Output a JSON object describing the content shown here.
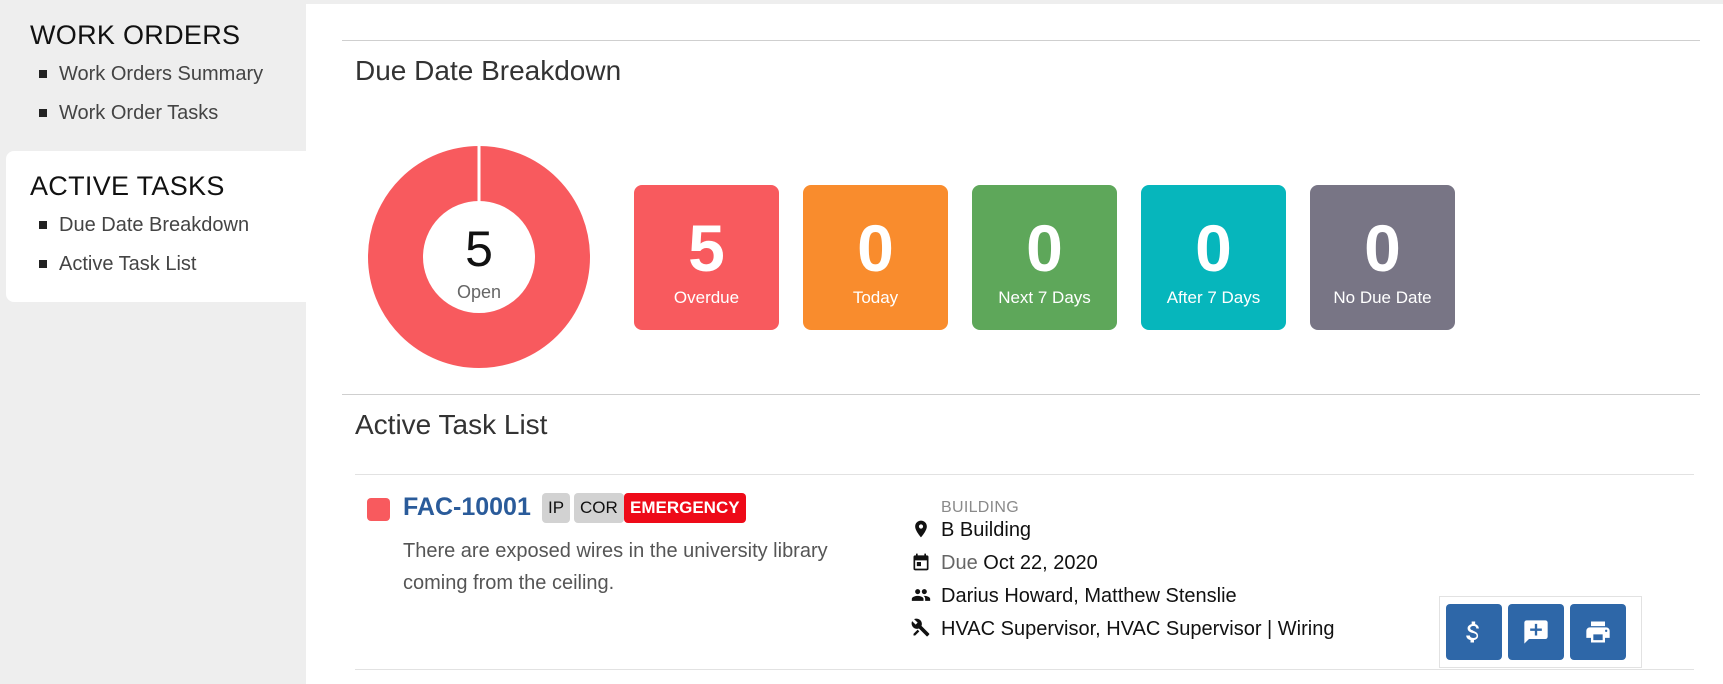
{
  "sidebar": {
    "groups": [
      {
        "title": "WORK ORDERS",
        "items": [
          {
            "label": "Work Orders Summary"
          },
          {
            "label": "Work Order Tasks"
          }
        ]
      },
      {
        "title": "ACTIVE TASKS",
        "items": [
          {
            "label": "Due Date Breakdown"
          },
          {
            "label": "Active Task List"
          }
        ]
      }
    ]
  },
  "breakdown": {
    "title": "Due Date Breakdown",
    "donut": {
      "value": "5",
      "label": "Open",
      "color": "#f85a5e"
    },
    "tiles": [
      {
        "value": "5",
        "label": "Overdue",
        "color": "#f85a5e"
      },
      {
        "value": "0",
        "label": "Today",
        "color": "#f98c2d"
      },
      {
        "value": "0",
        "label": "Next 7 Days",
        "color": "#5ea75a"
      },
      {
        "value": "0",
        "label": "After 7 Days",
        "color": "#06b6bc"
      },
      {
        "value": "0",
        "label": "No Due Date",
        "color": "#787585"
      }
    ]
  },
  "task_list": {
    "title": "Active Task List",
    "task": {
      "id": "FAC-10001",
      "badges": [
        "IP",
        "COR",
        "EMERGENCY"
      ],
      "description": " There are exposed wires in the university library coming from the ceiling.",
      "building_label": "BUILDING",
      "building": "B Building",
      "due_prefix": "Due",
      "due_date": "Oct 22, 2020",
      "assignees": "Darius Howard, Matthew Stenslie",
      "trades": "HVAC Supervisor, HVAC Supervisor | Wiring"
    }
  },
  "icons": {
    "location": "location-pin-icon",
    "calendar": "calendar-icon",
    "people": "people-icon",
    "tools": "tools-icon",
    "cost": "dollar-icon",
    "comment": "add-comment-icon",
    "print": "print-icon"
  },
  "colors": {
    "accent": "#2e67a8",
    "priority": "#f85a5e",
    "emergency": "#ee0a18"
  }
}
